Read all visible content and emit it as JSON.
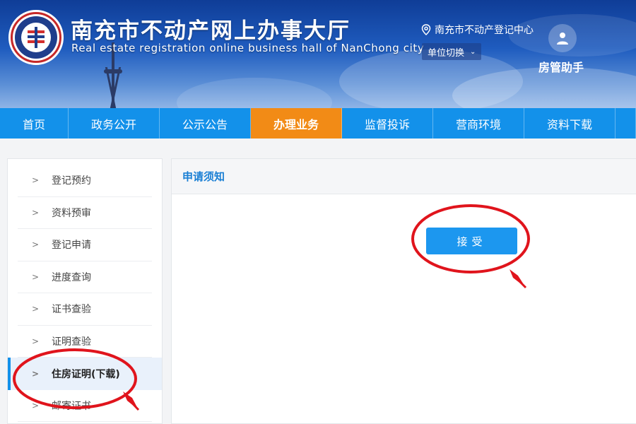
{
  "header": {
    "title": "南充市不动产网上办事大厅",
    "subtitle": "Real estate registration online business hall of NanChong city",
    "location": "南充市不动产登记中心",
    "unit_switch": "单位切换",
    "helper": "房管助手"
  },
  "nav": {
    "items": [
      {
        "label": "首页"
      },
      {
        "label": "政务公开"
      },
      {
        "label": "公示公告"
      },
      {
        "label": "办理业务"
      },
      {
        "label": "监督投诉"
      },
      {
        "label": "营商环境"
      },
      {
        "label": "资料下载"
      }
    ],
    "active_index": 3
  },
  "sidebar": {
    "items": [
      {
        "label": "登记预约"
      },
      {
        "label": "资料预审"
      },
      {
        "label": "登记申请"
      },
      {
        "label": "进度查询"
      },
      {
        "label": "证书查验"
      },
      {
        "label": "证明查验"
      },
      {
        "label": "住房证明(下载)"
      },
      {
        "label": "邮寄证书"
      }
    ],
    "active_index": 6
  },
  "main": {
    "heading": "申请须知",
    "accept_label": "接受"
  },
  "colors": {
    "nav_blue": "#1391ea",
    "nav_active_orange": "#f28b16",
    "heading_blue": "#1a7fd4",
    "button_blue": "#1c97ef",
    "annotation_red": "#e0141c"
  }
}
